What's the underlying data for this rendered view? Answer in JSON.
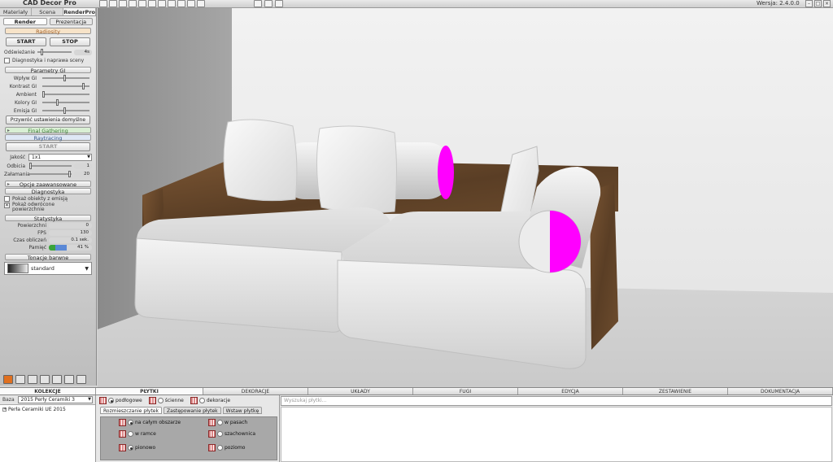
{
  "app": {
    "title": "CAD Decor Pro",
    "version": "Wersja: 2.4.0.0"
  },
  "left": {
    "tabs": [
      "Materiały",
      "Scena",
      "RenderPro"
    ],
    "subtabs": [
      "Render",
      "Prezentacja"
    ],
    "radiosity": {
      "header": "Radiosity",
      "start": "START",
      "stop": "STOP",
      "refresh_label": "Odświeżanie",
      "refresh_value": "4s",
      "diag_label": "Diagnostyka i naprawa sceny"
    },
    "gi": {
      "header": "Parametry GI",
      "rows": [
        {
          "label": "Wpływ GI"
        },
        {
          "label": "Kontrast GI"
        },
        {
          "label": "Ambient"
        },
        {
          "label": "Kolory GI"
        },
        {
          "label": "Emisja GI"
        }
      ],
      "reset": "Przywróć ustawienia domyślne"
    },
    "final_gathering": "Final Gathering",
    "raytracing": {
      "header": "Raytracing",
      "start": "START",
      "quality_label": "Jakość",
      "quality_value": "1x1",
      "reflections_label": "Odbicia",
      "reflections_value": "1",
      "refractions_label": "Załamania",
      "refractions_value": "20"
    },
    "advanced": "Opcje zaawansowane",
    "diagnostics": {
      "header": "Diagnostyka",
      "opt1": "Pokaż obiekty z emisją",
      "opt2_line1": "Pokaż odwrócone",
      "opt2_line2": "powierzchnie"
    },
    "stats": {
      "header": "Statystyka",
      "surfaces_label": "Powierzchni",
      "surfaces_value": "0",
      "fps_label": "FPS",
      "fps_value": "130",
      "time_label": "Czas obliczeń",
      "time_value": "0.1 sek.",
      "memory_label": "Pamięć",
      "memory_value": "41 %"
    },
    "tone": {
      "header": "Tonacje barwne",
      "value": "standard"
    }
  },
  "bottom_tabs": [
    "KOLEKCJE",
    "PŁYTKI",
    "DEKORACJE",
    "UKŁADY",
    "FUGI",
    "EDYCJA",
    "ZESTAWIENIE",
    "DOKUMENTACJA"
  ],
  "kolekcje": {
    "base_label": "Baza",
    "base_value": "2015 Perły Ceramiki 3",
    "item": "Perła Ceramiki UE 2015"
  },
  "plytki": {
    "radios": [
      "podłogowe",
      "ścienne",
      "dekoracje"
    ],
    "subtabs": [
      "Rozmieszczanie płytek",
      "Zastępowanie płytek",
      "Wstaw płytkę"
    ],
    "options": [
      "na całym obszarze",
      "w pasach",
      "w ramce",
      "szachownica",
      "pionowo",
      "poziomo"
    ]
  },
  "search": {
    "placeholder": "Wyszukaj płytki..."
  },
  "colors": {
    "accent_magenta": "#ff00ff",
    "wood": "#6b4a2c"
  }
}
